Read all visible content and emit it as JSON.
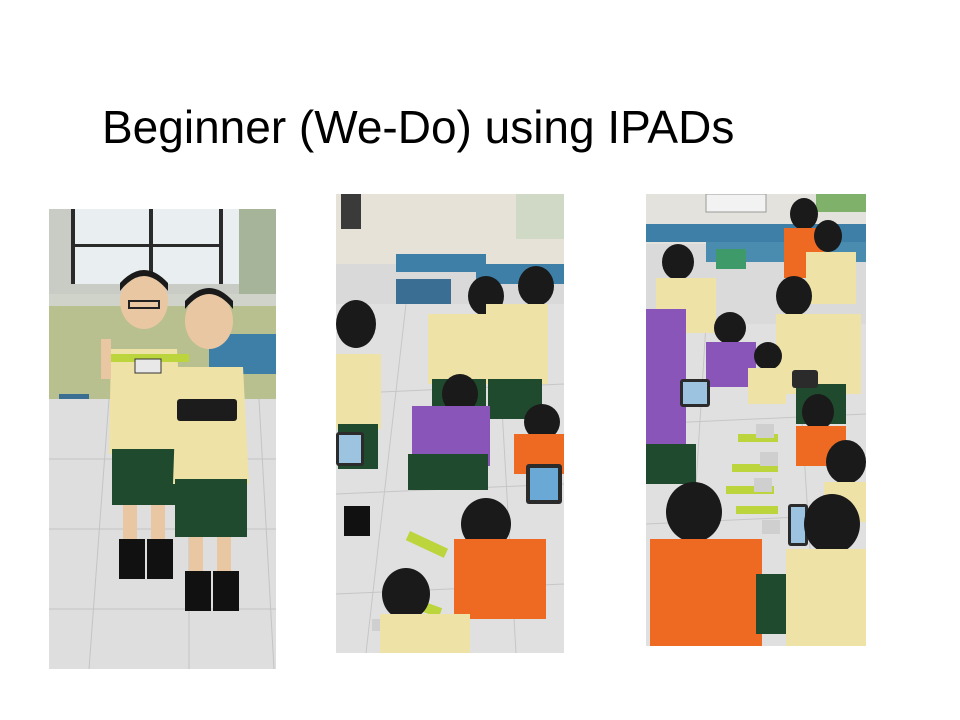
{
  "slide": {
    "title": "Beginner (We-Do) using IPADs"
  },
  "colors": {
    "shirt_khaki": "#efe2a6",
    "shorts_green": "#1f4a2e",
    "shirt_orange": "#ee6a22",
    "shirt_purple": "#8a55b8",
    "floor": "#dcdcdc",
    "table_blue": "#3e7fa8"
  }
}
